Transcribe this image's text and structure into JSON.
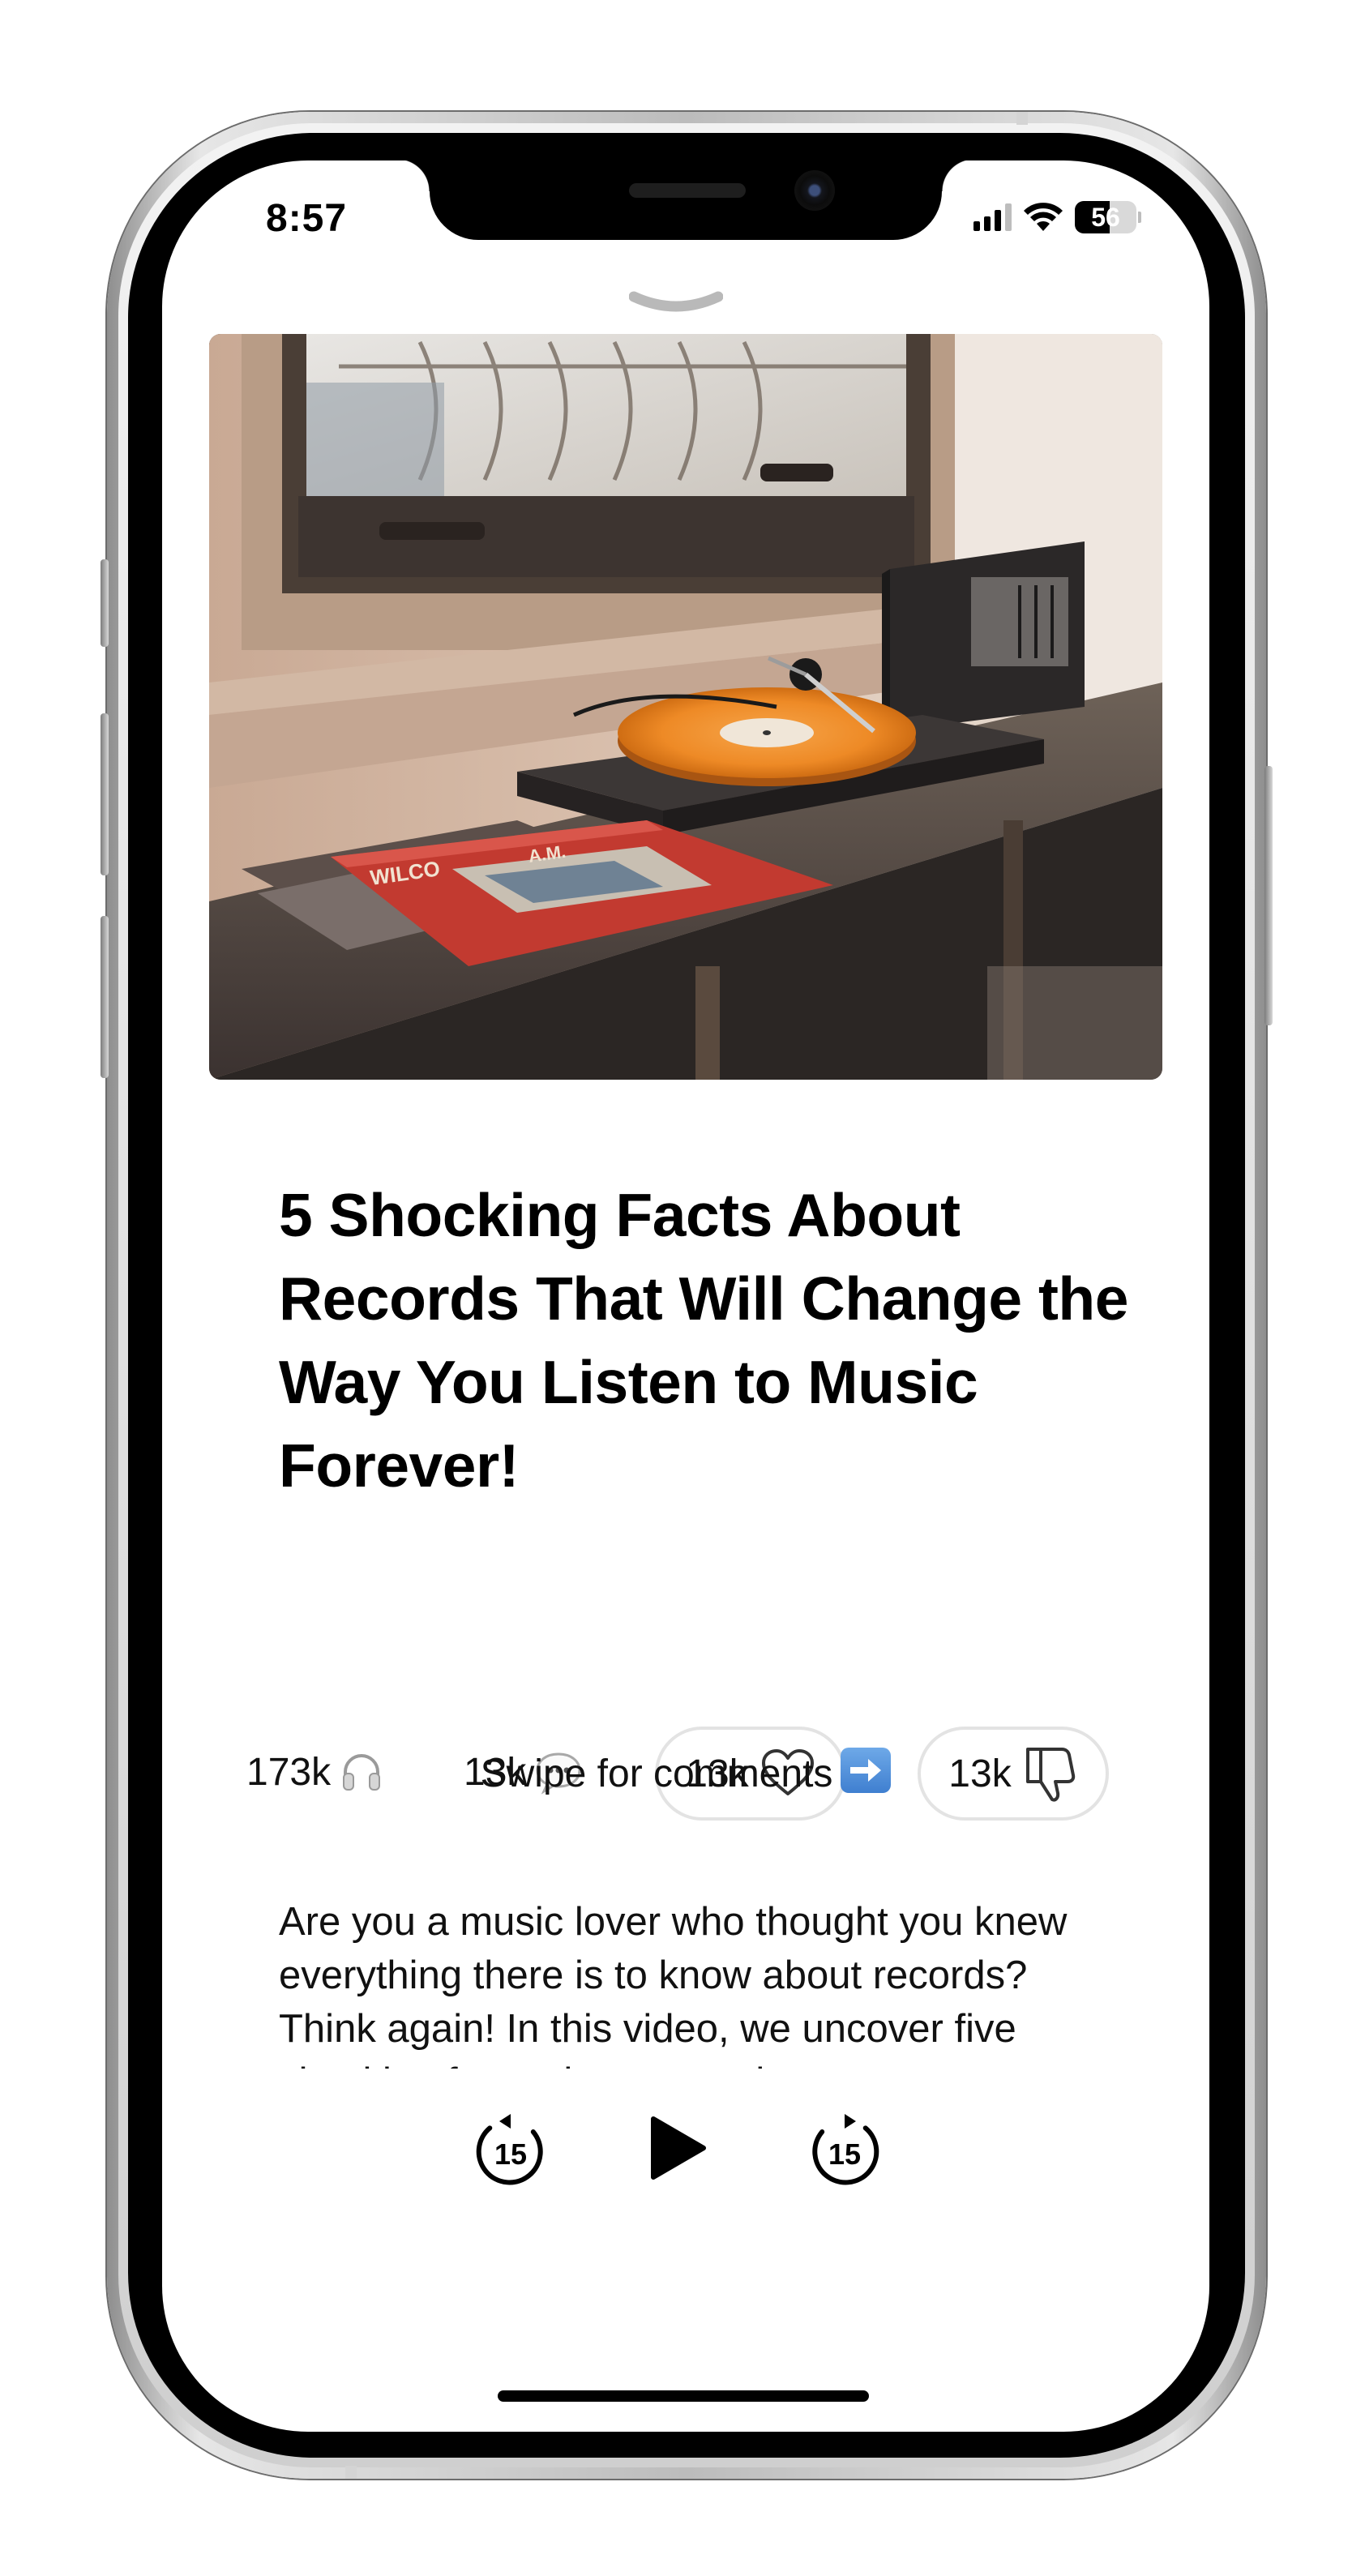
{
  "status_bar": {
    "time": "8:57",
    "battery_percent": "56",
    "battery_level": 0.56,
    "signal_bars": 3,
    "icons": [
      "signal-icon",
      "wifi-icon",
      "battery-icon"
    ]
  },
  "hero_image": {
    "description_icon": "record-player-photo"
  },
  "episode": {
    "title": "5 Shocking Facts About Records That Will Change the Way You Listen to Music Forever!",
    "description": "Are you a music lover who thought you knew everything there is to know about records? Think again! In this video, we uncover five shocking facts about records"
  },
  "stats": {
    "listens": "173k",
    "comments": "13k",
    "likes": "13k",
    "dislikes": "13k"
  },
  "swipe_hint": "Swipe for comments",
  "player": {
    "rewind_label": "15",
    "forward_label": "15",
    "state": "paused"
  },
  "colors": {
    "pill_border": "#e3e3e3",
    "text": "#111111",
    "arrow_emoji": "#3f7fd0"
  }
}
